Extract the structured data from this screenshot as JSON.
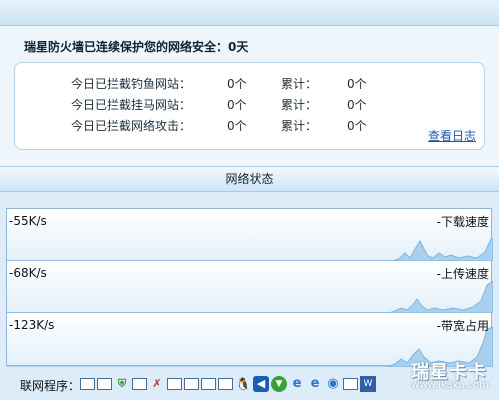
{
  "header": {
    "headline": "瑞星防火墙已连续保护您的网络安全：0天"
  },
  "stats": {
    "rows": [
      {
        "label": "今日已拦截钓鱼网站：",
        "today": "0个",
        "total_label": "累计：",
        "total": "0个"
      },
      {
        "label": "今日已拦截挂马网站：",
        "today": "0个",
        "total_label": "累计：",
        "total": "0个"
      },
      {
        "label": "今日已拦截网络攻击：",
        "today": "0个",
        "total_label": "累计：",
        "total": "0个"
      }
    ],
    "view_log_label": "查看日志"
  },
  "network_status": {
    "title": "网络状态",
    "rows": [
      {
        "scale": "-55K/s",
        "metric": "-下载速度"
      },
      {
        "scale": "-68K/s",
        "metric": "-上传速度"
      },
      {
        "scale": "-123K/s",
        "metric": "-带宽占用"
      }
    ]
  },
  "programs": {
    "label": "联网程序：",
    "icons": [
      "blank-window-icon",
      "blank-window-icon",
      "shield-icon",
      "blank-window-icon",
      "security-icon",
      "blank-window-icon",
      "blank-window-icon",
      "blank-window-icon",
      "blank-window-icon",
      "qq-penguin-icon",
      "back-arrow-icon",
      "download-icon",
      "ie-icon",
      "ie-icon",
      "globe-icon",
      "blank-window-icon",
      "document-icon"
    ]
  },
  "watermark": {
    "title": "瑞星卡卡",
    "url": "www.ikaka.com"
  },
  "colors": {
    "accent": "#1a58b0",
    "panel_background": "#eef6fc",
    "graph_fill": "#a9d0ee"
  }
}
